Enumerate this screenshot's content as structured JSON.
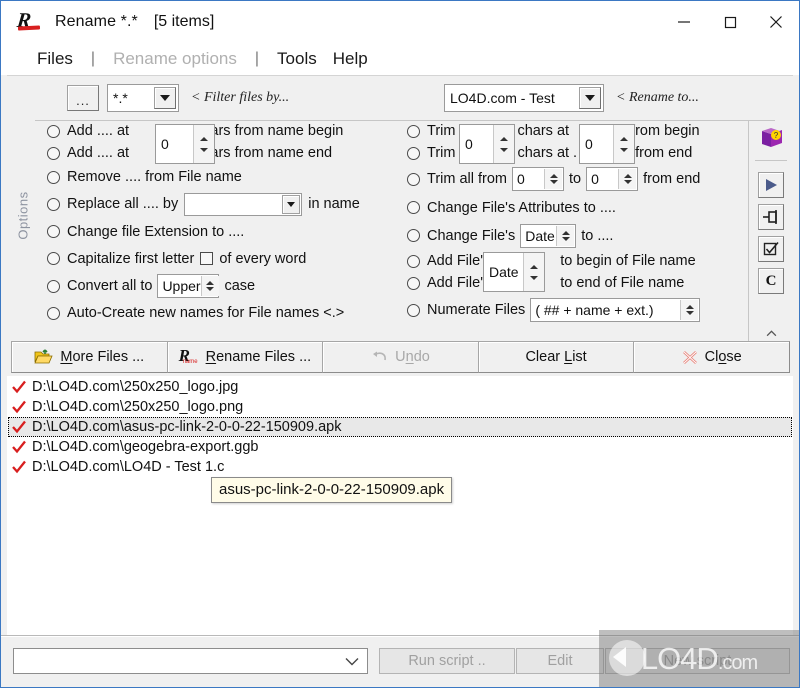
{
  "window": {
    "title": "Rename  *.*",
    "item_count": "[5 items]",
    "icon": "rename-app-icon",
    "minimize": "minimize-icon",
    "maximize": "maximize-icon",
    "close": "close-icon"
  },
  "menu": {
    "items": [
      {
        "label": "Files",
        "disabled": false
      },
      {
        "label": "Rename options",
        "disabled": true
      },
      {
        "label": "Tools",
        "disabled": false
      },
      {
        "label": "Help",
        "disabled": false
      }
    ],
    "separator": "|"
  },
  "toolbar": {
    "browse_button": "...",
    "filter_value": "*.*",
    "filter_hint": "< Filter files by...",
    "rename_value": "LO4D.com - Test",
    "rename_hint": "< Rename to...",
    "book_icon": "help-book-icon"
  },
  "options": {
    "section_label": "Options",
    "left": [
      {
        "id": "add-at-begin",
        "parts": [
          "Add .... at",
          "chars from name begin"
        ]
      },
      {
        "id": "add-at-end",
        "parts": [
          "Add .... at",
          "chars from name end"
        ]
      },
      {
        "id": "remove-from-name",
        "label": "Remove .... from File name"
      },
      {
        "id": "replace-all",
        "parts": [
          "Replace all .... by",
          "in name"
        ],
        "combo_value": ""
      },
      {
        "id": "change-extension",
        "label": "Change file Extension to ...."
      },
      {
        "id": "capitalize",
        "parts": [
          "Capitalize first letter",
          "of every word"
        ],
        "checkbox": false
      },
      {
        "id": "convert-case",
        "parts": [
          "Convert all to",
          "case"
        ],
        "spin_value": "Upper"
      },
      {
        "id": "auto-create",
        "label": "Auto-Create new names for File names <.>"
      }
    ],
    "left_shared_spin": "0",
    "right": [
      {
        "id": "trim-from-begin",
        "parts": [
          "Trim",
          "chars at",
          "from begin"
        ],
        "spin2": "0"
      },
      {
        "id": "trim-from-end",
        "parts": [
          "Trim",
          "chars at .",
          "from  end"
        ],
        "spin2": "0"
      },
      {
        "id": "trim-all",
        "parts": [
          "Trim all from",
          "to",
          "from end"
        ],
        "spin_a": "0",
        "spin_b": "0"
      },
      {
        "id": "change-attributes",
        "label": "Change File's Attributes to ...."
      },
      {
        "id": "change-date",
        "parts": [
          "Change File's",
          "to ...."
        ],
        "spin_value": "Date"
      },
      {
        "id": "add-to-begin",
        "parts": [
          "Add File's",
          "to begin of File name"
        ]
      },
      {
        "id": "add-to-end",
        "parts": [
          "Add File's",
          "to end of File name"
        ]
      },
      {
        "id": "numerate-files",
        "parts": [
          "Numerate Files"
        ],
        "spin_value": "( ## + name + ext.)"
      }
    ],
    "right_shared_spin": "0",
    "right_date_spin": "Date"
  },
  "side_tools": [
    {
      "id": "play",
      "icon": "play-icon"
    },
    {
      "id": "pin",
      "icon": "pin-icon"
    },
    {
      "id": "checkmark",
      "icon": "check-box-icon"
    },
    {
      "id": "c-button",
      "icon": "letter-c-icon",
      "label": "C"
    }
  ],
  "side_scroll": {
    "up": "chevron-up-icon",
    "down": "chevron-down-icon"
  },
  "actions": [
    {
      "id": "more-files",
      "label": "More Files ...",
      "accel": "M",
      "icon": "folder-open-icon",
      "disabled": false
    },
    {
      "id": "rename-files",
      "label": "Rename Files ...",
      "accel": "R",
      "icon": "rename-r-icon",
      "disabled": false
    },
    {
      "id": "undo",
      "label": "Undo",
      "accel": "n",
      "icon": "undo-arrow-icon",
      "disabled": true
    },
    {
      "id": "clear-list",
      "label": "Clear List",
      "accel": "L",
      "icon": "",
      "disabled": false
    },
    {
      "id": "close",
      "label": "Close",
      "accel": "o",
      "icon": "close-x-icon",
      "disabled": false
    }
  ],
  "file_list": [
    {
      "path": "D:\\LO4D.com\\250x250_logo.jpg",
      "selected": false,
      "checked": true
    },
    {
      "path": "D:\\LO4D.com\\250x250_logo.png",
      "selected": false,
      "checked": true
    },
    {
      "path": "D:\\LO4D.com\\asus-pc-link-2-0-0-22-150909.apk",
      "selected": true,
      "checked": true
    },
    {
      "path": "D:\\LO4D.com\\geogebra-export.ggb",
      "selected": false,
      "checked": true
    },
    {
      "path": "D:\\LO4D.com\\LO4D - Test 1.c",
      "selected": false,
      "checked": true
    }
  ],
  "tooltip": {
    "text": "asus-pc-link-2-0-0-22-150909.apk"
  },
  "bottom": {
    "script_value": "",
    "run_script": "Run script ..",
    "edit": "Edit",
    "new_script": "New script"
  },
  "watermark": {
    "text": "LO4D",
    "suffix": ".com"
  },
  "colors": {
    "window_border": "#3b78c3",
    "panel_bg": "#f0f0f0",
    "accent_red": "#d81f1f",
    "disabled_text": "#a8a8a8",
    "tooltip_bg": "#fffce8",
    "selection_bg": "#e8e8e8"
  }
}
